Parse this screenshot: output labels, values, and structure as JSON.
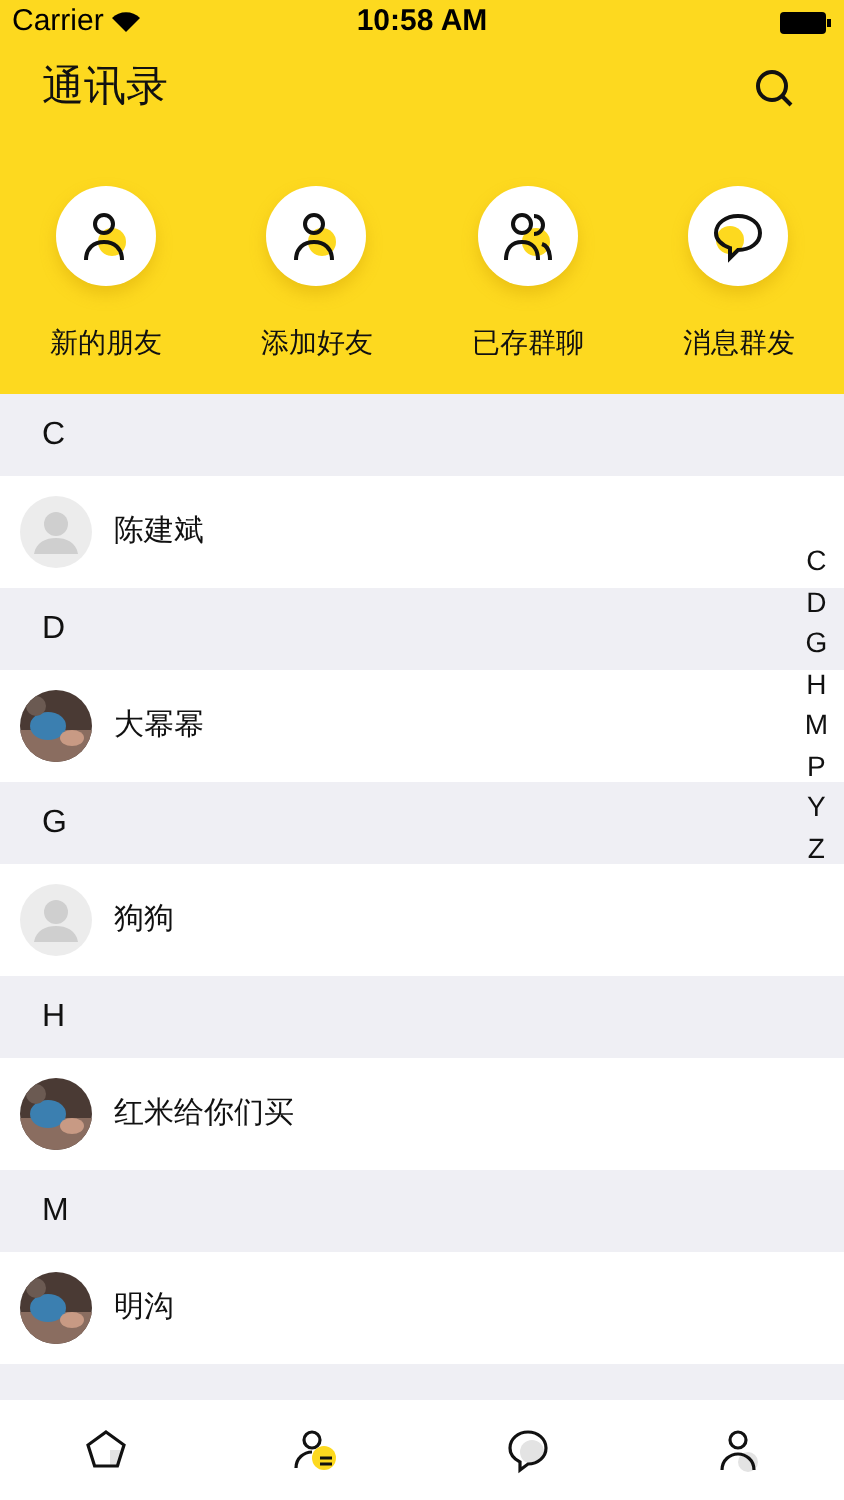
{
  "status_bar": {
    "carrier": "Carrier",
    "time": "10:58 AM"
  },
  "header": {
    "title": "通讯录"
  },
  "actions": [
    {
      "kind": "person",
      "label": "新的朋友"
    },
    {
      "kind": "person",
      "label": "添加好友"
    },
    {
      "kind": "group",
      "label": "已存群聊"
    },
    {
      "kind": "chat",
      "label": "消息群发"
    }
  ],
  "sections": [
    {
      "letter": "C",
      "contacts": [
        {
          "name": "陈建斌",
          "avatar": {
            "kind": "default"
          }
        }
      ]
    },
    {
      "letter": "D",
      "contacts": [
        {
          "name": "大幂幂"
        }
      ]
    },
    {
      "letter": "G",
      "contacts": [
        {
          "name": "狗狗",
          "avatar": {
            "kind": "default"
          }
        }
      ]
    },
    {
      "letter": "H",
      "contacts": [
        {
          "name": "红米给你们买"
        }
      ]
    },
    {
      "letter": "M",
      "contacts": [
        {
          "name": "明沟"
        }
      ]
    }
  ],
  "index": [
    "C",
    "D",
    "G",
    "H",
    "M",
    "P",
    "Y",
    "Z"
  ],
  "tab_bar": [
    {
      "kind": "home",
      "selected": false
    },
    {
      "kind": "contacts",
      "selected": true
    },
    {
      "kind": "chat",
      "selected": false
    },
    {
      "kind": "me",
      "selected": false
    }
  ]
}
